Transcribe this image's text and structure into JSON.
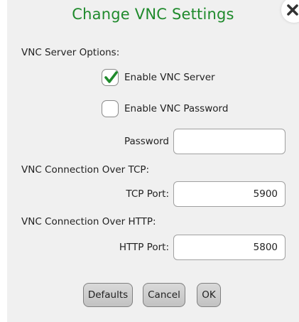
{
  "dialog": {
    "title": "Change VNC Settings",
    "close_icon": "close-icon",
    "title_color": "#1f8a2c"
  },
  "server_options": {
    "section_label": "VNC Server Options:",
    "enable_server_label": "Enable VNC Server",
    "enable_server_checked": true,
    "enable_password_label": "Enable VNC Password",
    "enable_password_checked": false,
    "password_label": "Password",
    "password_value": ""
  },
  "tcp": {
    "section_label": "VNC Connection Over TCP:",
    "port_label": "TCP Port:",
    "port_value": "5900"
  },
  "http": {
    "section_label": "VNC Connection Over HTTP:",
    "port_label": "HTTP Port:",
    "port_value": "5800"
  },
  "buttons": {
    "defaults": "Defaults",
    "cancel": "Cancel",
    "ok": "OK"
  }
}
